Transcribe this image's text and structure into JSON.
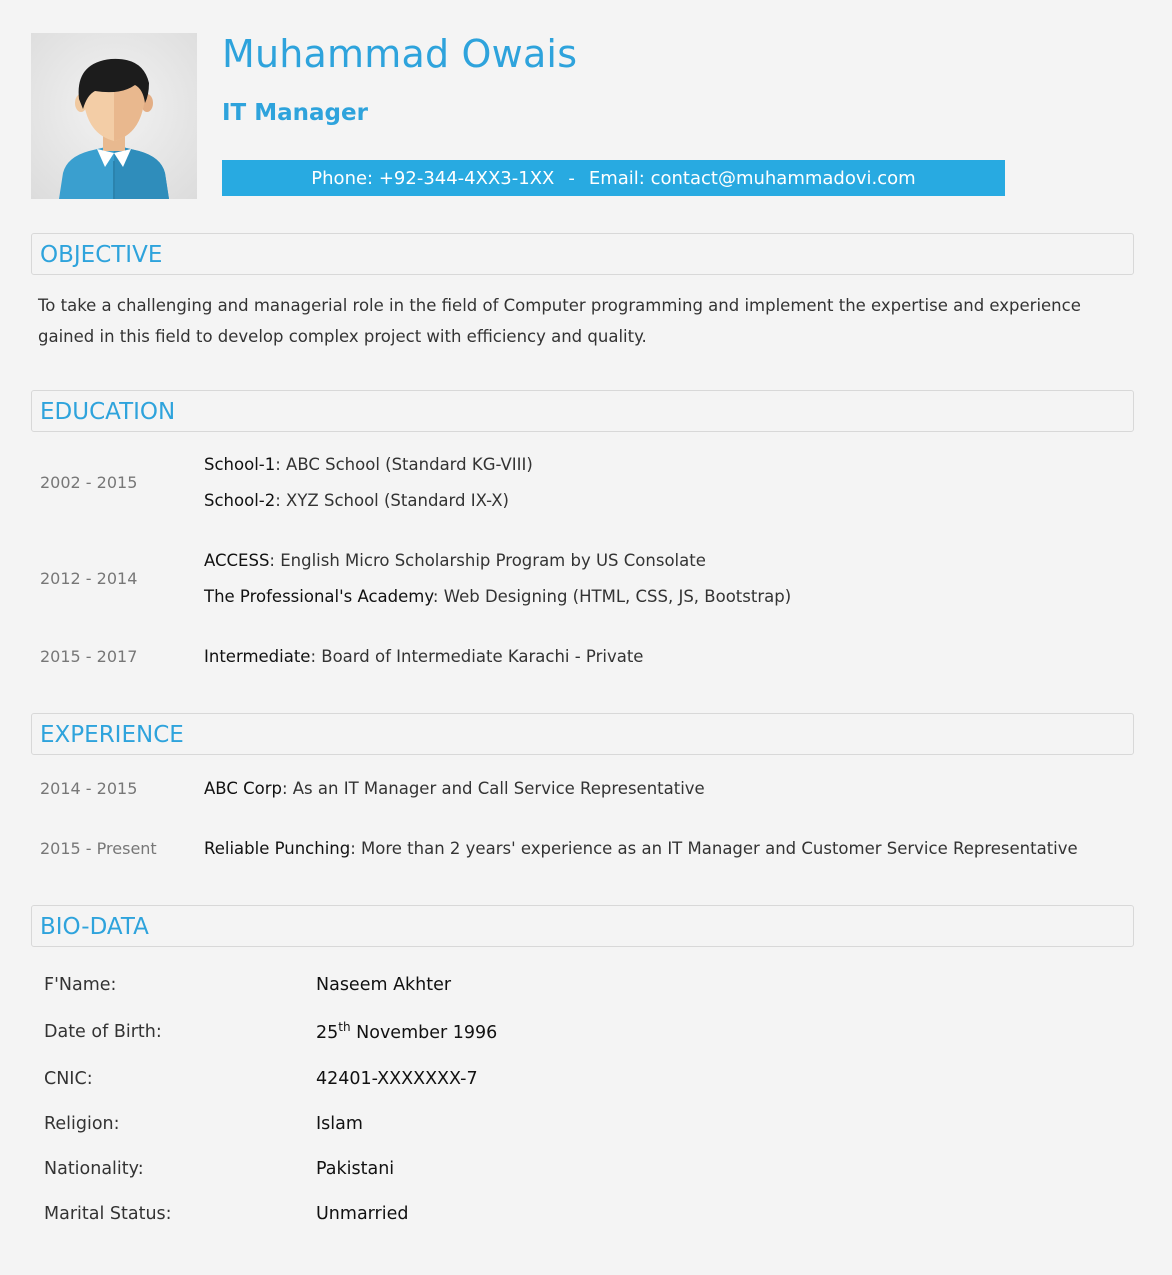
{
  "header": {
    "name": "Muhammad Owais",
    "role": "IT Manager",
    "phone": "Phone: +92-344-4XX3-1XX",
    "separator": "-",
    "email": "Email: contact@muhammadovi.com",
    "accent_color": "#2ea3dc",
    "bar_color": "#28aae1"
  },
  "objective": {
    "title": "OBJECTIVE",
    "text": "To take a challenging and managerial role in the field of Computer programming and implement the expertise and experience gained in this field to develop complex project with efficiency and quality."
  },
  "education": {
    "title": "EDUCATION",
    "entries": [
      {
        "period": "2002 - 2015",
        "items": [
          {
            "label": "School-1",
            "text": ": ABC School (Standard KG-VIII)"
          },
          {
            "label": "School-2",
            "text": ": XYZ School (Standard IX-X)"
          }
        ]
      },
      {
        "period": "2012 - 2014",
        "items": [
          {
            "label": "ACCESS",
            "text": ": English Micro Scholarship Program by US Consolate"
          },
          {
            "label": "The Professional's Academy",
            "text": ": Web Designing (HTML, CSS, JS, Bootstrap)"
          }
        ]
      },
      {
        "period": "2015 - 2017",
        "items": [
          {
            "label": "Intermediate",
            "text": ": Board of Intermediate Karachi - Private"
          }
        ]
      }
    ]
  },
  "experience": {
    "title": "EXPERIENCE",
    "entries": [
      {
        "period": "2014 - 2015",
        "label": "ABC Corp",
        "text": ": As an IT Manager and Call Service Representative"
      },
      {
        "period": "2015 - Present",
        "label": "Reliable Punching",
        "text": ": More than 2 years' experience as an IT Manager and Customer Service Representative"
      }
    ]
  },
  "biodata": {
    "title": "BIO-DATA",
    "fields": [
      {
        "label": "F'Name:",
        "value": "Naseem Akhter"
      },
      {
        "label": "Date of Birth:",
        "value_day": "25",
        "value_sup": "th",
        "value_rest": " November 1996"
      },
      {
        "label": "CNIC:",
        "value": "42401-XXXXXXX-7"
      },
      {
        "label": "Religion:",
        "value": "Islam"
      },
      {
        "label": "Nationality:",
        "value": "Pakistani"
      },
      {
        "label": "Marital Status:",
        "value": "Unmarried"
      }
    ]
  }
}
